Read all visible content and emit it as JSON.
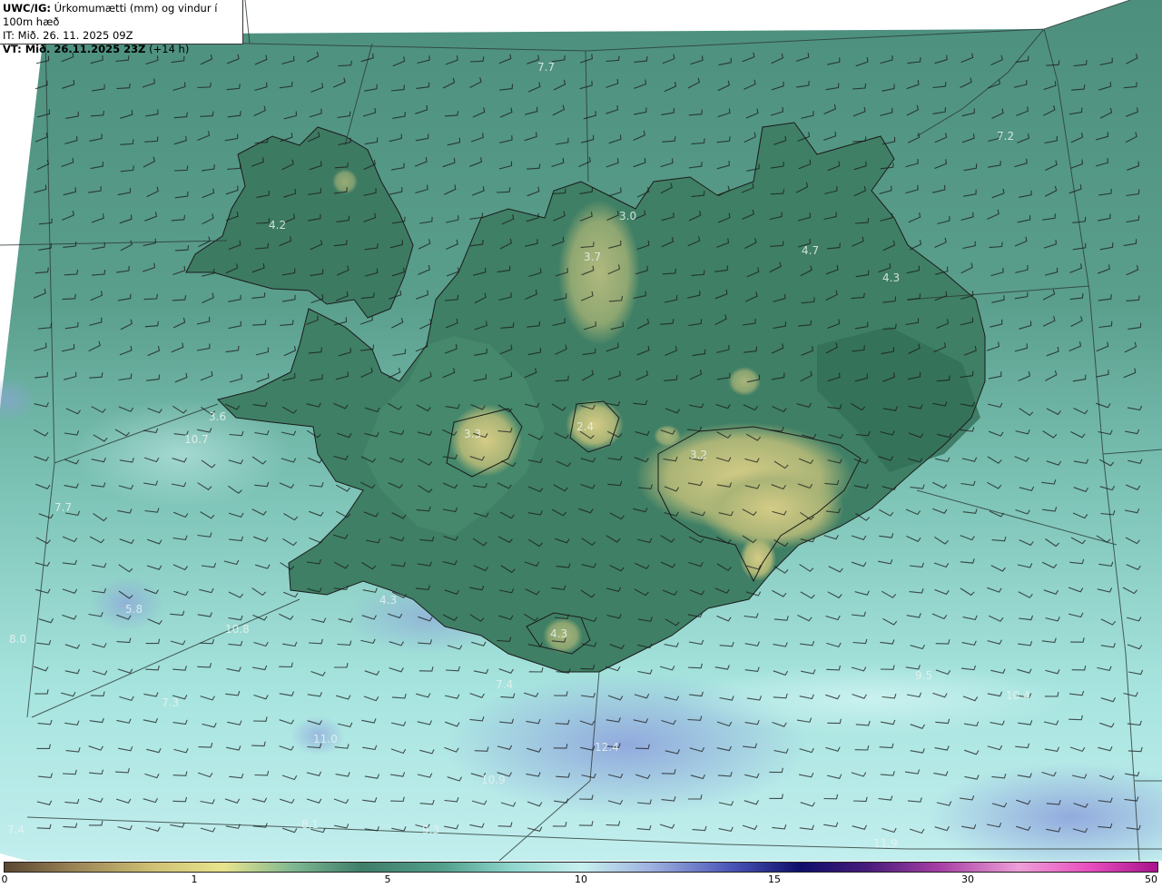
{
  "header": {
    "model_label": "UWC/IG:",
    "title": "Úrkomumætti (mm) og vindur í 100m hæð",
    "it": "IT: Mið. 26. 11. 2025 09Z",
    "vt_label": "VT: Mið. 26.11.2025 23Z",
    "vt_offset": "(+14 h)"
  },
  "map_labels": [
    "7.7",
    "7.2",
    "4.2",
    "3.0",
    "3.7",
    "4.7",
    "4.3",
    "3.6",
    "10.7",
    "3.3",
    "2.4",
    "3.2",
    "7.7",
    "5.8",
    "8.0",
    "10.8",
    "7.3",
    "4.3",
    "4.3",
    "7.4",
    "9.5",
    "10.4",
    "12.4",
    "11.0",
    "10.9",
    "8.1",
    "9.3",
    "7.4",
    "11.9"
  ],
  "colorbar": {
    "ticks": [
      "0",
      "1",
      "5",
      "10",
      "15",
      "30",
      "50"
    ],
    "colors": [
      "#5a4632",
      "#9a8456",
      "#cfc274",
      "#e8e48c",
      "#7fb892",
      "#3e7e6a",
      "#53a08c",
      "#8fd6cf",
      "#c7f0ef",
      "#9fb2e0",
      "#4a56b8",
      "#0e0e6a",
      "#4a1c7c",
      "#a63ea4",
      "#ee9fd8",
      "#e94fbf",
      "#a8128c"
    ]
  },
  "colors": {
    "land_green": "#3d7a62",
    "sea_teal": "#5ea491",
    "heavy_blue": "#9eb8e8",
    "glacier_yellow": "#bdbe7c"
  }
}
